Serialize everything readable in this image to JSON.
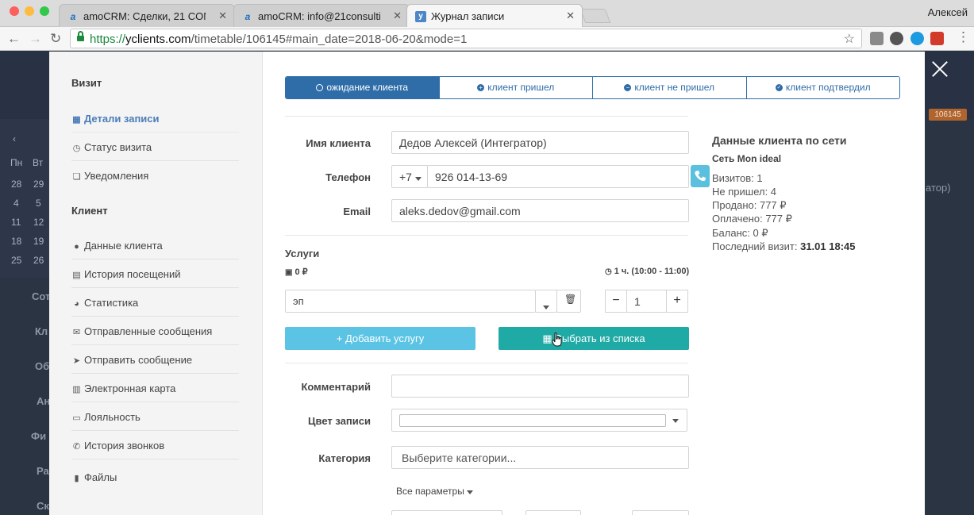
{
  "browser": {
    "tabs": [
      {
        "title": "amoCRM: Сделки, 21 CONSUL",
        "favicon": "a"
      },
      {
        "title": "amoCRM: info@21consulting.r",
        "favicon": "a"
      },
      {
        "title": "Журнал записи",
        "favicon": "y"
      }
    ],
    "user": "Алексей",
    "url": {
      "scheme": "https://",
      "host": "yclients.com",
      "path": "/timetable/106145#main_date=2018-06-20&mode=1"
    }
  },
  "background": {
    "weekdays": [
      "Пн",
      "Вт"
    ],
    "calendar_rows": [
      [
        "28",
        "29"
      ],
      [
        "4",
        "5"
      ],
      [
        "11",
        "12"
      ],
      [
        "18",
        "19"
      ],
      [
        "25",
        "26"
      ]
    ],
    "menu_fragments": [
      "Сот",
      "Кл",
      "Об",
      "Ан",
      "Фи",
      "Ра",
      "Ск"
    ],
    "right_badge": "106145",
    "right_text": "атор)"
  },
  "sidebar": {
    "visit_heading": "Визит",
    "visit_items": [
      {
        "label": "Детали записи",
        "icon": "calendar-icon",
        "active": true
      },
      {
        "label": "Статус визита",
        "icon": "clock-icon"
      },
      {
        "label": "Уведомления",
        "icon": "comments-icon"
      }
    ],
    "client_heading": "Клиент",
    "client_items": [
      {
        "label": "Данные клиента",
        "icon": "user-icon"
      },
      {
        "label": "История посещений",
        "icon": "list-icon"
      },
      {
        "label": "Статистика",
        "icon": "pie-chart-icon"
      },
      {
        "label": "Отправленные сообщения",
        "icon": "envelope-icon"
      },
      {
        "label": "Отправить сообщение",
        "icon": "paper-plane-icon"
      },
      {
        "label": "Электронная карта",
        "icon": "barcode-icon"
      },
      {
        "label": "Лояльность",
        "icon": "credit-card-icon"
      },
      {
        "label": "История звонков",
        "icon": "phone-icon"
      },
      {
        "label": "Файлы",
        "icon": "file-icon"
      }
    ]
  },
  "status_tabs": [
    {
      "label": "ожидание клиента",
      "icon": "clock-icon"
    },
    {
      "label": "клиент пришел",
      "icon": "plus-circle-icon"
    },
    {
      "label": "клиент не пришел",
      "icon": "minus-circle-icon"
    },
    {
      "label": "клиент подтвердил",
      "icon": "check-circle-icon"
    }
  ],
  "form": {
    "name_label": "Имя клиента",
    "name_value": "Дедов Алексей (Интегратор)",
    "phone_label": "Телефон",
    "phone_code": "+7",
    "phone_value": "926 014-13-69",
    "email_label": "Email",
    "email_value": "aleks.dedov@gmail.com",
    "comment_label": "Комментарий",
    "comment_value": "",
    "color_label": "Цвет записи",
    "category_label": "Категория",
    "category_placeholder": "Выберите категории...",
    "all_params": "Все параметры"
  },
  "client_network": {
    "title": "Данные клиента по сети",
    "network": "Сеть Mon ideal",
    "visits": "Визитов: 1",
    "no_show": "Не пришел: 4",
    "sold": "Продано: 777 ₽",
    "paid": "Оплачено: 777 ₽",
    "balance": "Баланс: 0 ₽",
    "last_visit_label": "Последний визит:",
    "last_visit_value": "31.01 18:45"
  },
  "services": {
    "title": "Услуги",
    "total": "0 ₽",
    "duration": "1 ч. (10:00 - 11:00)",
    "service_value": "эп",
    "quantity": "1",
    "add_label": "Добавить услугу",
    "choose_label": "Выбрать из списка"
  },
  "colors": {
    "primary": "#2f6da8",
    "add_button": "#5bc4e5",
    "choose_button": "#20aaa6",
    "phone_button": "#5bc0de"
  }
}
